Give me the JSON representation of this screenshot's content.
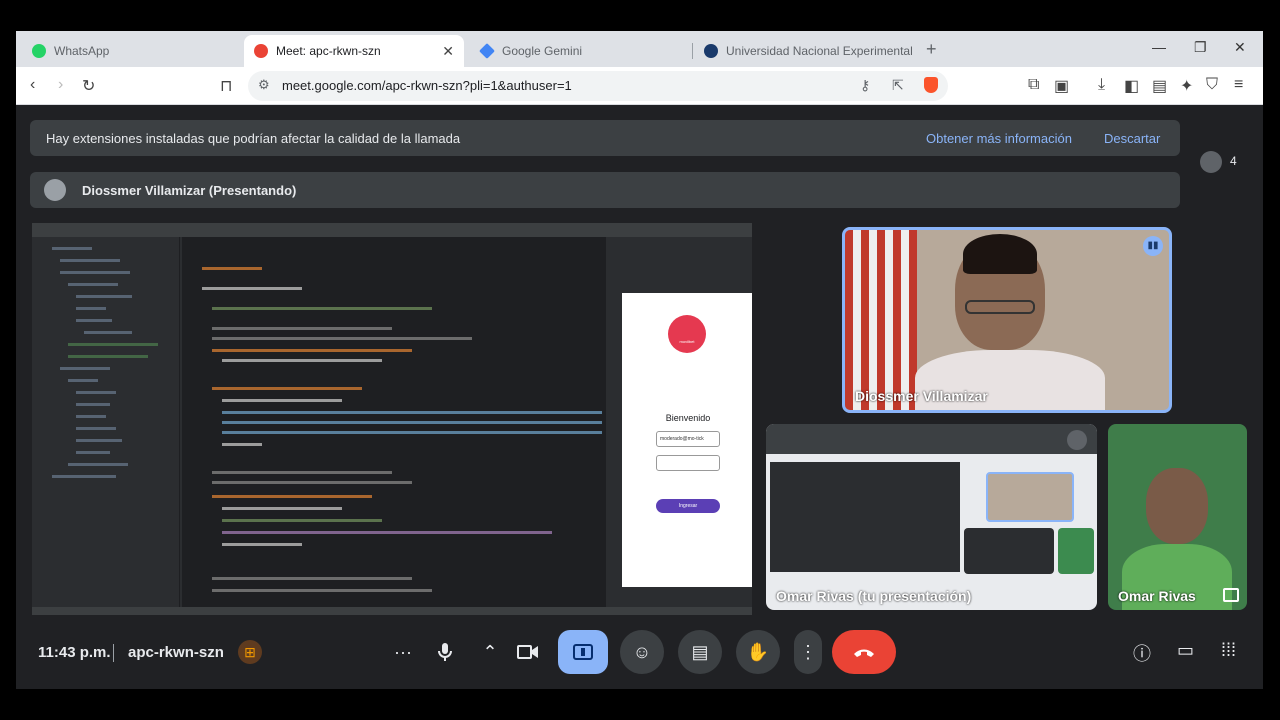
{
  "browser": {
    "tabs": [
      {
        "title": "WhatsApp",
        "icon": "whatsapp-icon",
        "color": "#25d366"
      },
      {
        "title": "Meet: apc-rkwn-szn",
        "icon": "meet-icon",
        "color": "#ea4335"
      },
      {
        "title": "Google Gemini",
        "icon": "gemini-icon",
        "color": "#4285f4"
      },
      {
        "title": "Universidad Nacional Experimental d",
        "icon": "university-icon",
        "color": "#1a3a6b"
      }
    ],
    "url": "meet.google.com/apc-rkwn-szn?pli=1&authuser=1"
  },
  "banner": {
    "message": "Hay extensiones instaladas que podrían afectar la calidad de la llamada",
    "more_info": "Obtener más información",
    "dismiss": "Descartar"
  },
  "presenter": {
    "label": "Diossmer Villamizar (Presentando)"
  },
  "participants_count": "4",
  "shared_screen": {
    "app_title": "Bienvenido",
    "field_user": "moderado@mo-tick",
    "button": "Ingresar",
    "logo_text": "movilbet"
  },
  "tiles": [
    {
      "name": "Diossmer Villamizar"
    },
    {
      "name": "Omar Rivas (tu presentación)"
    },
    {
      "name": "Omar Rivas"
    }
  ],
  "bottom": {
    "time": "11:43 p.m.",
    "meeting_code": "apc-rkwn-szn"
  },
  "colors": {
    "accent": "#8ab4f8",
    "leave": "#ea4335",
    "bg": "#202124"
  }
}
